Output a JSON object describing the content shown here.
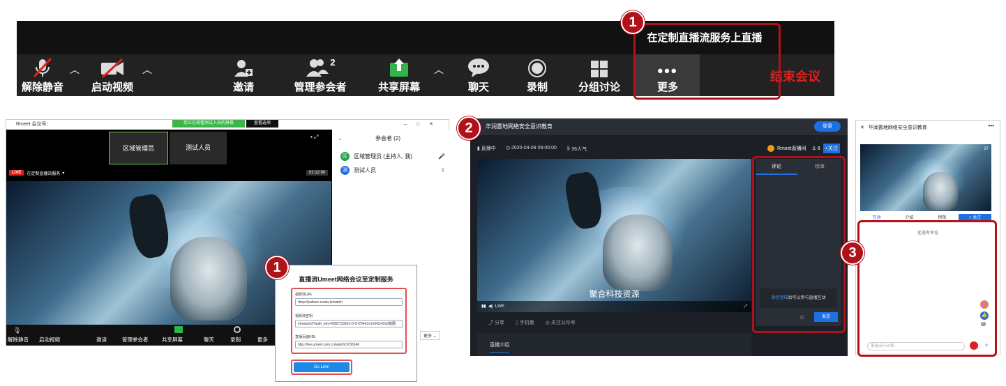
{
  "toolbar": {
    "unmute": "解除静音",
    "start_video": "启动视频",
    "invite": "邀请",
    "manage_participants": "管理参会者",
    "participant_count": "2",
    "share_screen": "共享屏幕",
    "chat": "聊天",
    "record": "录制",
    "breakout": "分组讨论",
    "more": "更多",
    "end_meeting": "结束会议",
    "more_menu_item": "在定制直播流服务上直播"
  },
  "badges": {
    "one": "1",
    "two": "2",
    "three": "3"
  },
  "meeting_window": {
    "title": "Rmeet 会议号：",
    "green_banner": "您正在观看测试人员的屏幕",
    "view_options": "查看选项",
    "tile1": "区域管理员",
    "tile2": "测试人员",
    "live_badge": "LIVE",
    "live_text": "在定制直播流服务",
    "timer": "02:12:00",
    "participants_header": "参会者 (2)",
    "participants": [
      {
        "avatar": "区",
        "name": "区域管理员 (主持人, 我)",
        "color": "#2ca24f"
      },
      {
        "avatar": "测",
        "name": "测试人员",
        "color": "#2a6fd6"
      }
    ],
    "more_button": "更多",
    "bottom_toolbar": [
      "解除静音",
      "启动视频",
      "邀请",
      "管理参会者",
      "共享屏幕",
      "聊天",
      "录制",
      "更多"
    ]
  },
  "dialog": {
    "title": "直播流Umeet网络会议至定制服务",
    "stream_url_label": "视频流URL",
    "stream_url_value": "rtmp://pubsec.rsudu.tv/watch",
    "stream_key_label": "视频流密钥",
    "stream_key_value": "/mssa2e3?auth_key=2082733261-0-0-f764e1e7e0fdc42c8篇圈",
    "page_url_label": "直播页面URL",
    "page_url_value": "http://live.umeet.com.cn/watch/3708146",
    "go_live": "Go Live!"
  },
  "live_page": {
    "title": "华润置地网络安全意识教育",
    "login": "登录",
    "status": "直播中",
    "date": "2020-04-09 09:00:00",
    "viewers": "36人气",
    "channel": "Rmeet直播间",
    "followers": "8",
    "follow": "+关注",
    "tab_comments": "评论",
    "tab_rank": "榜单",
    "login_prompt_link": "微信登陆",
    "login_prompt_text": "后可以参与直播互动",
    "send": "发送",
    "subtitle": "聚合科技资源",
    "live_label": "LIVE",
    "share": "分享",
    "mobile": "手机看",
    "follow_wechat": "关注公众号",
    "intro_tab": "直播介绍"
  },
  "mobile_page": {
    "title": "华润置地网络安全意识教育",
    "count": "37",
    "tabs": [
      "互动",
      "介绍",
      "榜单"
    ],
    "follow": "+ 关注",
    "no_comments": "还没有评论",
    "input_placeholder": "来说点什么吧...",
    "like_count": "0"
  }
}
